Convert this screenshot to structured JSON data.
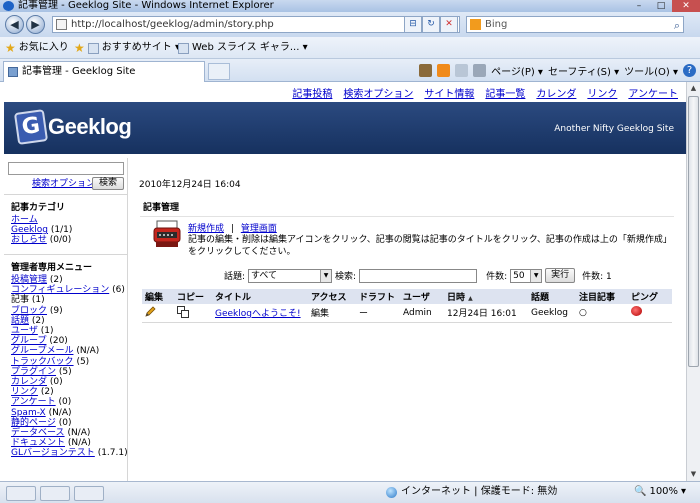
{
  "window": {
    "title": "記事管理 - Geeklog Site - Windows Internet Explorer",
    "minimize": "–",
    "maximize": "□",
    "close": "✕"
  },
  "nav": {
    "back": "◀",
    "forward": "▶",
    "url": "http://localhost/geeklog/admin/story.php",
    "search_engine": "Bing",
    "search_icon": "⌕"
  },
  "favorites": {
    "favorites_label": "お気に入り",
    "suggested_sites": "おすすめサイト ▾",
    "web_slice": "Web スライス ギャラ... ▾"
  },
  "tabs": [
    {
      "label": "記事管理 - Geeklog Site"
    }
  ],
  "command_bar": {
    "page_menu": "ページ(P) ▾",
    "safety_menu": "セーフティ(S) ▾",
    "tools_menu": "ツール(O) ▾",
    "help": "?"
  },
  "site": {
    "top_menu": [
      "記事投稿",
      "検索オプション",
      "サイト情報",
      "記事一覧",
      "カレンダ",
      "リンク",
      "アンケート"
    ],
    "logo_text": "Geeklog",
    "logo_letter": "G",
    "tagline": "Another Nifty Geeklog Site"
  },
  "sidebar": {
    "search_option": "検索オプション",
    "search_button": "検索",
    "categories_title": "記事カテゴリ",
    "categories": [
      {
        "label": "ホーム",
        "count": ""
      },
      {
        "label": "Geeklog",
        "count": "(1/1)"
      },
      {
        "label": "おしらせ",
        "count": "(0/0)"
      }
    ],
    "admin_title": "管理者専用メニュー",
    "admin_items": [
      {
        "label": "投稿管理",
        "count": "(2)",
        "link": true
      },
      {
        "label": "コンフィギュレーション",
        "count": "(6)",
        "link": true
      },
      {
        "label": "記事",
        "count": "(1)",
        "link": false
      },
      {
        "label": "ブロック",
        "count": "(9)",
        "link": true
      },
      {
        "label": "話題",
        "count": "(2)",
        "link": true
      },
      {
        "label": "ユーザ",
        "count": "(1)",
        "link": true
      },
      {
        "label": "グループ",
        "count": "(20)",
        "link": true
      },
      {
        "label": "グループメール",
        "count": "(N/A)",
        "link": true
      },
      {
        "label": "トラックバック",
        "count": "(5)",
        "link": true
      },
      {
        "label": "プラグイン",
        "count": "(5)",
        "link": true
      },
      {
        "label": "カレンダ",
        "count": "(0)",
        "link": true
      },
      {
        "label": "リンク",
        "count": "(2)",
        "link": true
      },
      {
        "label": "アンケート",
        "count": "(0)",
        "link": true
      },
      {
        "label": "Spam-X",
        "count": "(N/A)",
        "link": true
      },
      {
        "label": "静的ページ",
        "count": "(0)",
        "link": true
      },
      {
        "label": "データベース",
        "count": "(N/A)",
        "link": true
      },
      {
        "label": "ドキュメント",
        "count": "(N/A)",
        "link": true
      },
      {
        "label": "GLバージョンテスト",
        "count": "(1.7.1)",
        "link": true
      }
    ]
  },
  "main": {
    "date": "2010年12月24日 16:04",
    "section_title": "記事管理",
    "new_story": "新規作成",
    "separator": "|",
    "admin_home": "管理画面",
    "description": "記事の編集・削除は編集アイコンをクリック、記事の閲覧は記事のタイトルをクリック、記事の作成は上の「新規作成」をクリックしてください。",
    "filter": {
      "topic_label": "話題:",
      "topic_value": "すべて",
      "search_label": "検索:",
      "count_label": "件数:",
      "count_value": "50",
      "run_button": "実行",
      "result_label": "件数: 1"
    },
    "table": {
      "headers": [
        "編集",
        "コピー",
        "タイトル",
        "アクセス",
        "ドラフト",
        "ユーザ",
        "日時",
        "話題",
        "注目記事",
        "ピング"
      ],
      "rows": [
        {
          "title": "Geeklogへようこそ!",
          "access": "編集",
          "draft": "ー",
          "user": "Admin",
          "date": "12月24日 16:01",
          "topic": "Geeklog",
          "featured": "○"
        }
      ]
    }
  },
  "status": {
    "zone": "インターネット | 保護モード: 無効",
    "zoom": "100%"
  },
  "colors": {
    "banner": "#1f3d70",
    "link": "#0000cc",
    "table_header": "#dde3f0"
  }
}
